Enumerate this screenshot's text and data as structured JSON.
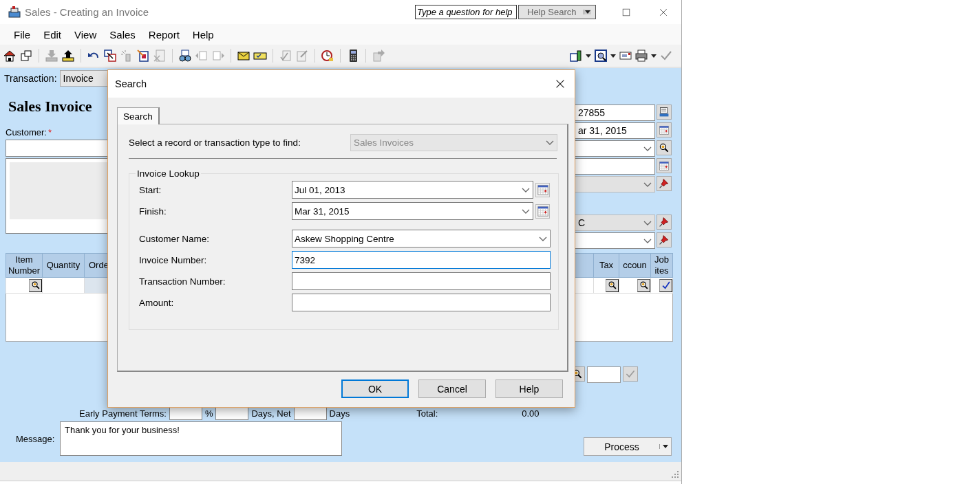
{
  "window": {
    "title": "Sales - Creating an Invoice",
    "help_question": {
      "placeholder": "Type a question for help"
    },
    "help_search": "Help Search"
  },
  "menu": [
    "File",
    "Edit",
    "View",
    "Sales",
    "Report",
    "Help"
  ],
  "transaction": {
    "label": "Transaction:",
    "value": "Invoice"
  },
  "heading": "Sales Invoice",
  "customer": {
    "label": "Customer:",
    "required_mark": "*"
  },
  "invoice_fields": [
    {
      "kind": "text",
      "value": "27855",
      "disabled": false
    },
    {
      "kind": "text",
      "value": "ar 31, 2015",
      "disabled": false
    },
    {
      "kind": "dropdown",
      "disabled": false
    },
    {
      "kind": "text",
      "disabled": false
    },
    {
      "kind": "dropdown",
      "disabled": true
    }
  ],
  "shipping_fields": [
    {
      "kind": "dropdown",
      "value": "C",
      "disabled": true
    },
    {
      "kind": "dropdown",
      "disabled": false
    }
  ],
  "table": {
    "columns_left": [
      "Item Number",
      "Quantity",
      "Orde"
    ],
    "columns_right": [
      "Tax",
      "ccoun",
      "Job ites"
    ]
  },
  "early_payment": {
    "label": "Early Payment Terms:",
    "percent": "%",
    "days_net": "Days, Net",
    "days": "Days"
  },
  "total": {
    "label": "Total:",
    "value": "0.00"
  },
  "message": {
    "label": "Message:",
    "value": "Thank you for your business!"
  },
  "process_button": "Process",
  "dialog": {
    "title": "Search",
    "tabs": [
      {
        "label": "Search",
        "selected": true
      }
    ],
    "record_type": {
      "label": "Select a record or transaction type to find:",
      "value": "Sales Invoices",
      "disabled": true
    },
    "group": "Invoice Lookup",
    "fields": [
      {
        "kind": "date",
        "label": "Start:",
        "value": "Jul 01, 2013",
        "focused": false
      },
      {
        "kind": "date",
        "label": "Finish:",
        "value": "Mar 31, 2015",
        "focused": false
      },
      {
        "kind": "dropdown",
        "label": "Customer Name:",
        "value": "Askew Shopping Centre",
        "focused": false
      },
      {
        "kind": "text",
        "label": "Invoice Number:",
        "value": "7392",
        "focused": true
      },
      {
        "kind": "text",
        "label": "Transaction Number:",
        "focused": false
      },
      {
        "kind": "text",
        "label": "Amount:",
        "focused": false
      }
    ],
    "buttons": [
      {
        "label": "OK",
        "default": true
      },
      {
        "label": "Cancel",
        "default": false
      },
      {
        "label": "Help",
        "default": false
      }
    ]
  }
}
